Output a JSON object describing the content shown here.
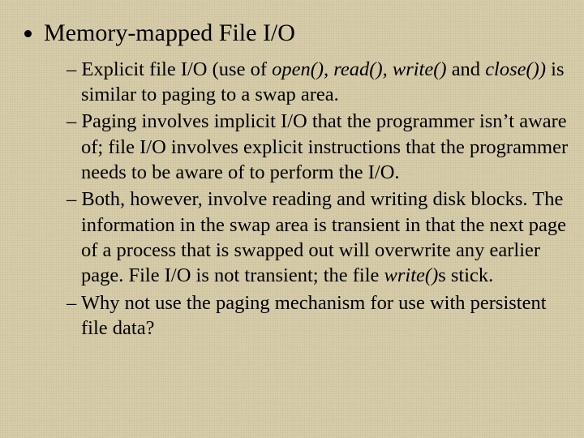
{
  "title": "Memory-mapped File I/O",
  "sub": {
    "s1a": "Explicit file I/O (use of ",
    "s1b": "open(), read(), write() ",
    "s1c": "and ",
    "s1d": "close())",
    "s1e": " is similar to paging to a swap area.",
    "s2": "Paging involves implicit I/O that the programmer isn’t aware of; file I/O involves explicit instructions that the programmer needs to be aware of to perform the I/O.",
    "s3a": "Both, however, involve reading and writing disk blocks.  The information in the swap area is transient in that the next page of a process that is swapped out will overwrite any earlier page.  File I/O is not transient; the file ",
    "s3b": "write()",
    "s3c": "s stick.",
    "s4": "Why not use the paging mechanism for use with persistent file data?"
  }
}
